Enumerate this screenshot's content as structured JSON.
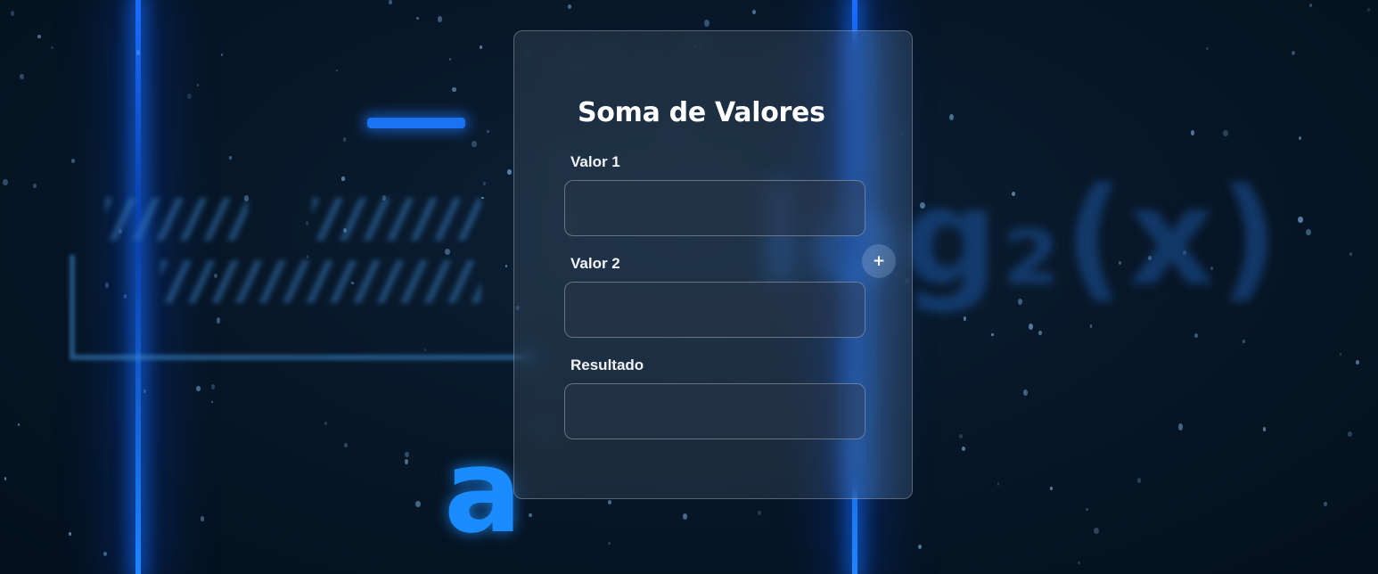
{
  "app": {
    "title": "Soma de Valores"
  },
  "form": {
    "fields": [
      {
        "label": "Valor 1",
        "value": "",
        "placeholder": ""
      },
      {
        "label": "Valor 2",
        "value": "",
        "placeholder": ""
      },
      {
        "label": "Resultado",
        "value": "",
        "placeholder": ""
      }
    ],
    "add_button_icon": "plus-icon",
    "add_button_glyph": "+"
  },
  "background": {
    "formula_text": "log₂(x)",
    "letter": "a"
  },
  "colors": {
    "background": "#071626",
    "accent": "#1a8cff",
    "card_border": "rgba(255,255,255,0.28)",
    "text": "#ffffff"
  }
}
